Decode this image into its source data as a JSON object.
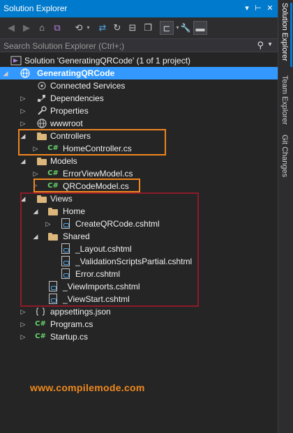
{
  "window": {
    "title": "Solution Explorer",
    "pin_glyph": "⊞",
    "dropdown_glyph": "▾",
    "autohide_glyph": "⊢",
    "close_glyph": "✕"
  },
  "search": {
    "placeholder": "Search Solution Explorer (Ctrl+;)",
    "icon_glyph": "⚲",
    "drop_glyph": "▼"
  },
  "toolbar": {
    "back_glyph": "◀",
    "forward_glyph": "▶",
    "home_glyph": "⌂",
    "switch_views_glyph": "⧉",
    "history_glyph": "⟲",
    "history_drop_glyph": "▾",
    "sync_glyph": "⇄",
    "refresh_glyph": "↻",
    "collapse_glyph": "⊟",
    "show_all_glyph": "❐",
    "tree_view_glyph": "⊏",
    "tree_drop_glyph": "▾",
    "properties_glyph": "🔧",
    "preview_glyph": "▬"
  },
  "tree": {
    "solution": "Solution 'GeneratingQRCode' (1 of 1 project)",
    "project": "GeneratingQRCode",
    "items": {
      "connected_services": "Connected Services",
      "dependencies": "Dependencies",
      "properties": "Properties",
      "wwwroot": "wwwroot",
      "controllers": "Controllers",
      "home_controller": "HomeController.cs",
      "models": "Models",
      "error_view_model": "ErrorViewModel.cs",
      "qrcode_model": "QRCodeModel.cs",
      "views": "Views",
      "home": "Home",
      "create_qrcode": "CreateQRCode.cshtml",
      "shared": "Shared",
      "layout": "_Layout.cshtml",
      "validation_scripts": "_ValidationScriptsPartial.cshtml",
      "error": "Error.cshtml",
      "view_imports": "_ViewImports.cshtml",
      "view_start": "_ViewStart.cshtml",
      "appsettings": "appsettings.json",
      "program": "Program.cs",
      "startup": "Startup.cs"
    },
    "cs_badge": "C#",
    "expanded_glyph": "◢",
    "collapsed_glyph": "▷"
  },
  "watermark": "www.compilemode.com",
  "side_tabs": {
    "solution_explorer": "Solution Explorer",
    "team_explorer": "Team Explorer",
    "git_changes": "Git Changes"
  },
  "colors": {
    "accent": "#007acc",
    "selection": "#3399ff",
    "highlight_orange": "#f0861f",
    "highlight_red": "#8e1b2a",
    "csharp_green": "#68d46b",
    "folder": "#dcb67a",
    "watermark": "#f08a1c"
  }
}
